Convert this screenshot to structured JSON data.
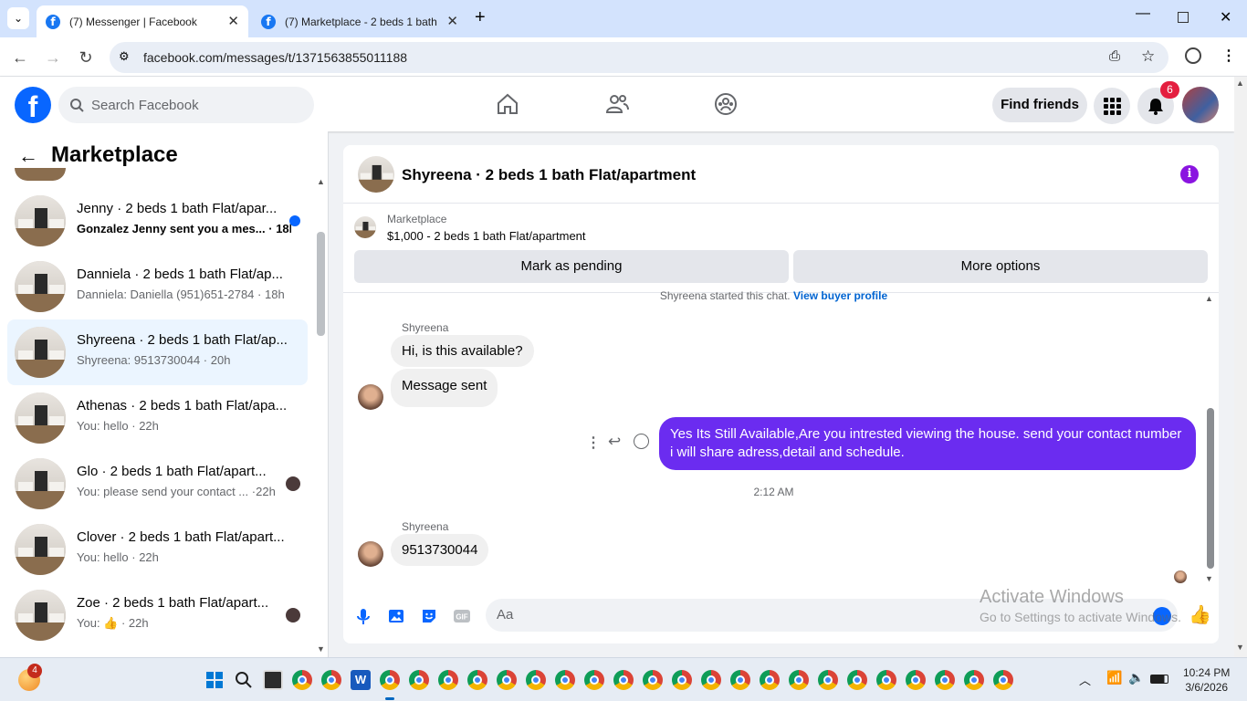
{
  "browser": {
    "tabs": [
      {
        "title": "(7) Messenger | Facebook",
        "active": true
      },
      {
        "title": "(7) Marketplace - 2 beds 1 bath",
        "active": false
      }
    ],
    "url": "facebook.com/messages/t/1371563855011188"
  },
  "fb_header": {
    "logo": "f",
    "search_placeholder": "Search Facebook",
    "find_friends": "Find friends",
    "notification_count": "6"
  },
  "sidebar": {
    "title": "Marketplace",
    "conversations": [
      {
        "title": "Jenny · 2 beds 1 bath Flat/apar...",
        "preview": "Gonzalez Jenny sent you a mes...",
        "time": "18h",
        "unread": true
      },
      {
        "title": "Danniela · 2 beds 1 bath Flat/ap...",
        "preview": "Danniela: Daniella (951)651-2784",
        "time": "18h",
        "unread": false
      },
      {
        "title": "Shyreena · 2 beds 1 bath Flat/ap...",
        "preview": "Shyreena: 9513730044",
        "time": "20h",
        "selected": true
      },
      {
        "title": "Athenas · 2 beds 1 bath Flat/apa...",
        "preview": "You: hello",
        "time": "22h"
      },
      {
        "title": "Glo · 2 beds 1 bath Flat/apart...",
        "preview": "You: please send your contact ...",
        "time": "22h"
      },
      {
        "title": "Clover · 2 beds 1 bath Flat/apart...",
        "preview": "You: hello",
        "time": "22h"
      },
      {
        "title": "Zoe · 2 beds 1 bath Flat/apart...",
        "preview": "You: ",
        "time": "22h"
      }
    ]
  },
  "chat": {
    "title": "Shyreena · 2 beds 1 bath Flat/apartment",
    "marketplace_label": "Marketplace",
    "listing": "$1,000 - 2 beds 1 bath Flat/apartment",
    "mark_pending": "Mark as pending",
    "more_options": "More options",
    "started": "Shyreena started this chat.",
    "view_profile": "View buyer profile",
    "sender_name": "Shyreena",
    "msg1": "Hi, is this available?",
    "msg2": "Message sent",
    "msg_out": "Yes Its Still Available,Are you intrested viewing the house. send your contact number i will share adress,detail and schedule.",
    "time": "2:12 AM",
    "sender_name2": "Shyreena",
    "msg3": "9513730044",
    "composer_placeholder": "Aa"
  },
  "watermark": {
    "line1": "Activate Windows",
    "line2": "Go to Settings to activate Windows."
  },
  "taskbar": {
    "time": "10:24 PM",
    "date": "3/6/2026",
    "badge": "4"
  },
  "colors": {
    "fb_blue": "#0866ff",
    "outgoing": "#6b2cf0"
  }
}
